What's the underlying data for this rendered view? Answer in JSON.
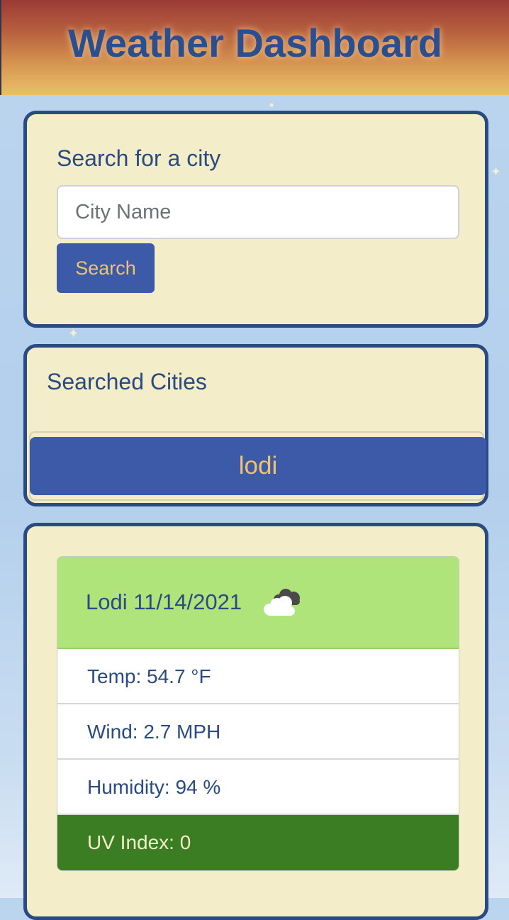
{
  "header": {
    "title": "Weather Dashboard"
  },
  "search": {
    "label": "Search for a city",
    "placeholder": "City Name",
    "value": "",
    "button_label": "Search"
  },
  "history": {
    "title": "Searched Cities",
    "items": [
      {
        "label": "lodi"
      }
    ]
  },
  "current": {
    "heading": "Lodi 11/14/2021",
    "icon": "cloud-icon",
    "temp": "Temp: 54.7 °F",
    "wind": "Wind: 2.7 MPH",
    "humidity": "Humidity: 94 %",
    "uv": "UV Index: 0",
    "uv_color": "#3a7d22"
  },
  "colors": {
    "accent": "#3d5aa8",
    "button_text": "#f0c46c",
    "card_bg": "#f3edc9",
    "card_border": "#2a4a82",
    "header_bg_top": "#9b3a36",
    "header_bg_bottom": "#e9bf6a",
    "weather_head_bg": "#afe47b"
  }
}
